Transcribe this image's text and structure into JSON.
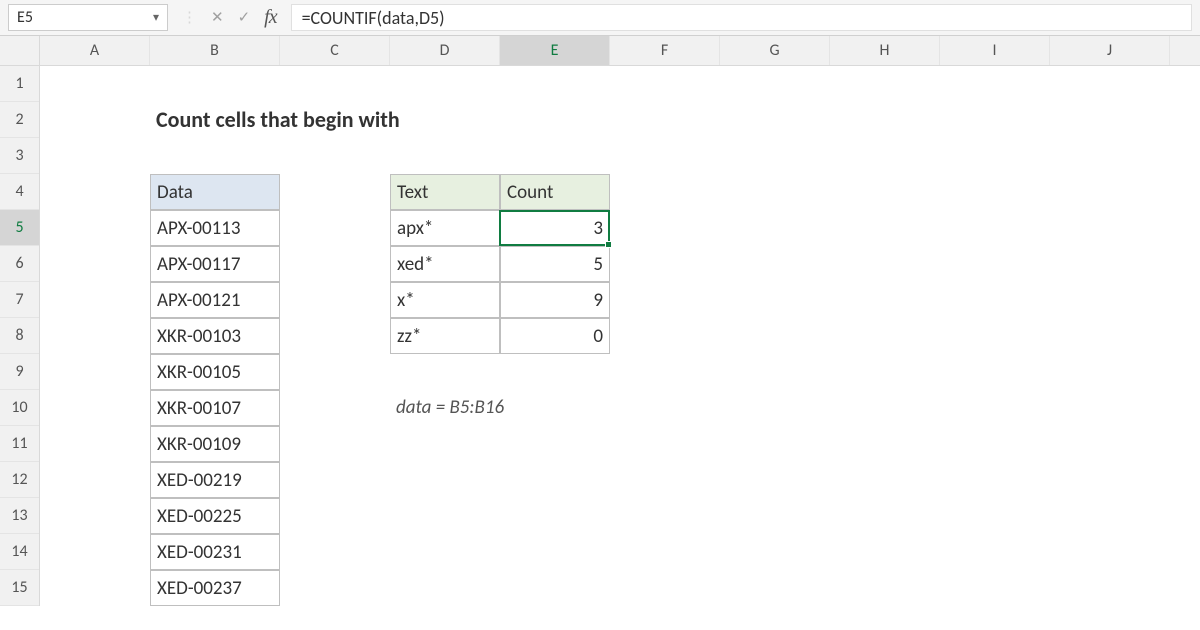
{
  "formula_bar": {
    "name_box": "E5",
    "fx_label": "fx",
    "formula": "=COUNTIF(data,D5)"
  },
  "columns": [
    "A",
    "B",
    "C",
    "D",
    "E",
    "F",
    "G",
    "H",
    "I",
    "J"
  ],
  "rows": [
    "1",
    "2",
    "3",
    "4",
    "5",
    "6",
    "7",
    "8",
    "9",
    "10",
    "11",
    "12",
    "13",
    "14",
    "15"
  ],
  "title": "Count cells that begin with",
  "data_header": "Data",
  "data_values": [
    "APX-00113",
    "APX-00117",
    "APX-00121",
    "XKR-00103",
    "XKR-00105",
    "XKR-00107",
    "XKR-00109",
    "XED-00219",
    "XED-00225",
    "XED-00231",
    "XED-00237"
  ],
  "text_header": "Text",
  "count_header": "Count",
  "text_values": [
    "apx*",
    "xed*",
    "x*",
    "zz*"
  ],
  "count_values": [
    "3",
    "5",
    "9",
    "0"
  ],
  "note": "data = B5:B16",
  "selected_cell": "E5"
}
